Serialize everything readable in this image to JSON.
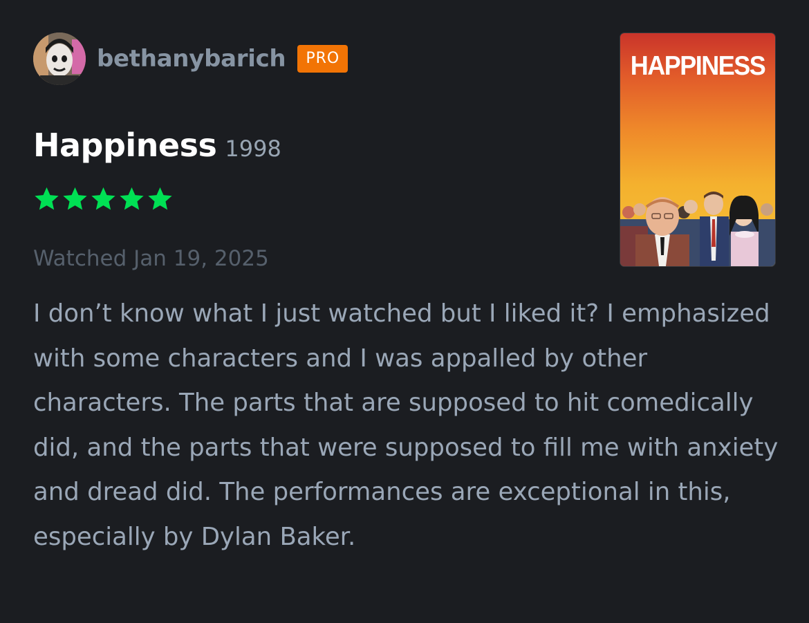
{
  "user": {
    "username": "bethanybarich",
    "badge": "PRO"
  },
  "film": {
    "title": "Happiness",
    "year": "1998",
    "rating_stars": 5,
    "rating_max": 5,
    "poster_title": "HAPPINESS"
  },
  "watched_label": "Watched Jan 19, 2025",
  "review_text": "I don’t know what I just watched but I liked it? I emphasized with some characters and I was appalled by other characters. The parts that are supposed to hit comedically did, and the parts that were supposed to fill me with anxiety and dread did. The performances are exceptional in this, especially by Dylan Baker.",
  "colors": {
    "background": "#1b1d21",
    "star": "#00e054",
    "pro_badge": "#f27405"
  },
  "icons": {
    "star": "star-icon"
  }
}
